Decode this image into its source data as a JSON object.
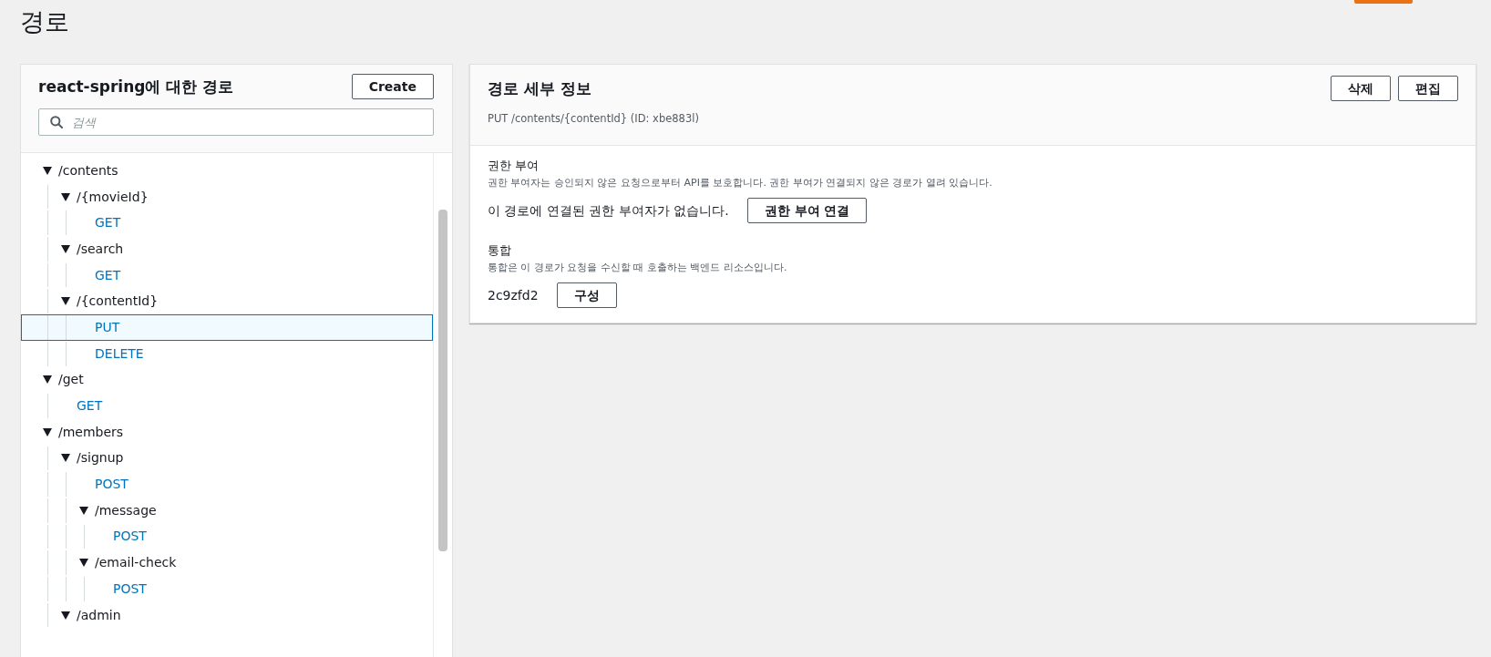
{
  "page_title": "경로",
  "routes_panel": {
    "title": "react-spring에 대한 경로",
    "create_button": "Create",
    "search": {
      "placeholder": "검색"
    },
    "tree": [
      {
        "kind": "resource",
        "label": "/contents",
        "expanded": true,
        "children": [
          {
            "kind": "resource",
            "label": "/{movieId}",
            "expanded": true,
            "children": [
              {
                "kind": "method",
                "label": "GET",
                "selected": false
              }
            ]
          },
          {
            "kind": "resource",
            "label": "/search",
            "expanded": true,
            "children": [
              {
                "kind": "method",
                "label": "GET",
                "selected": false
              }
            ]
          },
          {
            "kind": "resource",
            "label": "/{contentId}",
            "expanded": true,
            "children": [
              {
                "kind": "method",
                "label": "PUT",
                "selected": true
              },
              {
                "kind": "method",
                "label": "DELETE",
                "selected": false
              }
            ]
          }
        ]
      },
      {
        "kind": "resource",
        "label": "/get",
        "expanded": true,
        "children": [
          {
            "kind": "method",
            "label": "GET",
            "selected": false
          }
        ]
      },
      {
        "kind": "resource",
        "label": "/members",
        "expanded": true,
        "children": [
          {
            "kind": "resource",
            "label": "/signup",
            "expanded": true,
            "children": [
              {
                "kind": "method",
                "label": "POST",
                "selected": false
              },
              {
                "kind": "resource",
                "label": "/message",
                "expanded": true,
                "children": [
                  {
                    "kind": "method",
                    "label": "POST",
                    "selected": false
                  }
                ]
              },
              {
                "kind": "resource",
                "label": "/email-check",
                "expanded": true,
                "children": [
                  {
                    "kind": "method",
                    "label": "POST",
                    "selected": false
                  }
                ]
              }
            ]
          },
          {
            "kind": "resource",
            "label": "/admin",
            "expanded": true
          }
        ]
      }
    ]
  },
  "details_panel": {
    "title": "경로 세부 정보",
    "buttons": [
      "삭제",
      "편집"
    ],
    "subtitle": "PUT /contents/{contentId} (ID: xbe883l)",
    "sections": [
      {
        "heading": "권한 부여",
        "description": "권한 부여자는 승인되지 않은 요청으로부터 API를 보호합니다. 권한 부여가 연결되지 않은 경로가 열려 있습니다.",
        "value": "이 경로에 연결된 권한 부여자가 없습니다.",
        "button": "권한 부여 연결"
      },
      {
        "heading": "통합",
        "description": "통합은 이 경로가 요청을 수신할 때 호출하는 백엔드 리소스입니다.",
        "value": "2c9zfd2",
        "button": "구성"
      }
    ]
  }
}
